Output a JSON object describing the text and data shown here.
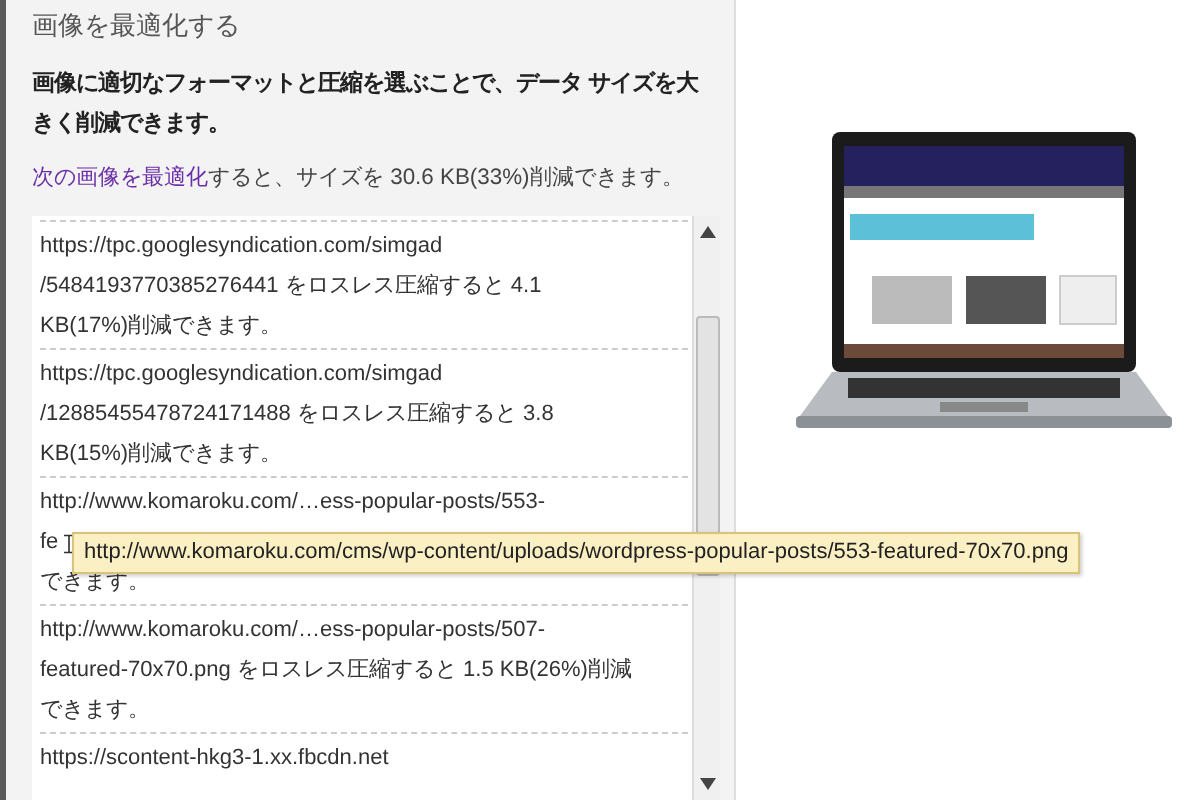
{
  "section_title": "画像を最適化する",
  "summary": "画像に適切なフォーマットと圧縮を選ぶことで、データ サイズを大きく削減できます。",
  "savings": {
    "link": "次の画像を最適化",
    "text": "すると、サイズを 30.6 KB(33%)削減できます。"
  },
  "items": [
    {
      "lines": [
        "https://tpc.googlesyndication.com/simgad",
        "/5484193770385276441 をロスレス圧縮すると 4.1",
        "KB(17%)削減できます。"
      ]
    },
    {
      "lines": [
        "https://tpc.googlesyndication.com/simgad",
        "/12885455478724171488 をロスレス圧縮すると 3.8",
        "KB(15%)削減できます。"
      ]
    },
    {
      "lines": [
        "http://www.komaroku.com/…ess-popular-posts/553-",
        "fe",
        "できます。"
      ]
    },
    {
      "lines": [
        "http://www.komaroku.com/…ess-popular-posts/507-",
        "featured-70x70.png をロスレス圧縮すると 1.5 KB(26%)削減",
        "できます。"
      ]
    },
    {
      "lines": [
        "https://scontent-hkg3-1.xx.fbcdn.net"
      ]
    }
  ],
  "tooltip": "http://www.komaroku.com/cms/wp-content/uploads/wordpress-popular-posts/553-featured-70x70.png"
}
